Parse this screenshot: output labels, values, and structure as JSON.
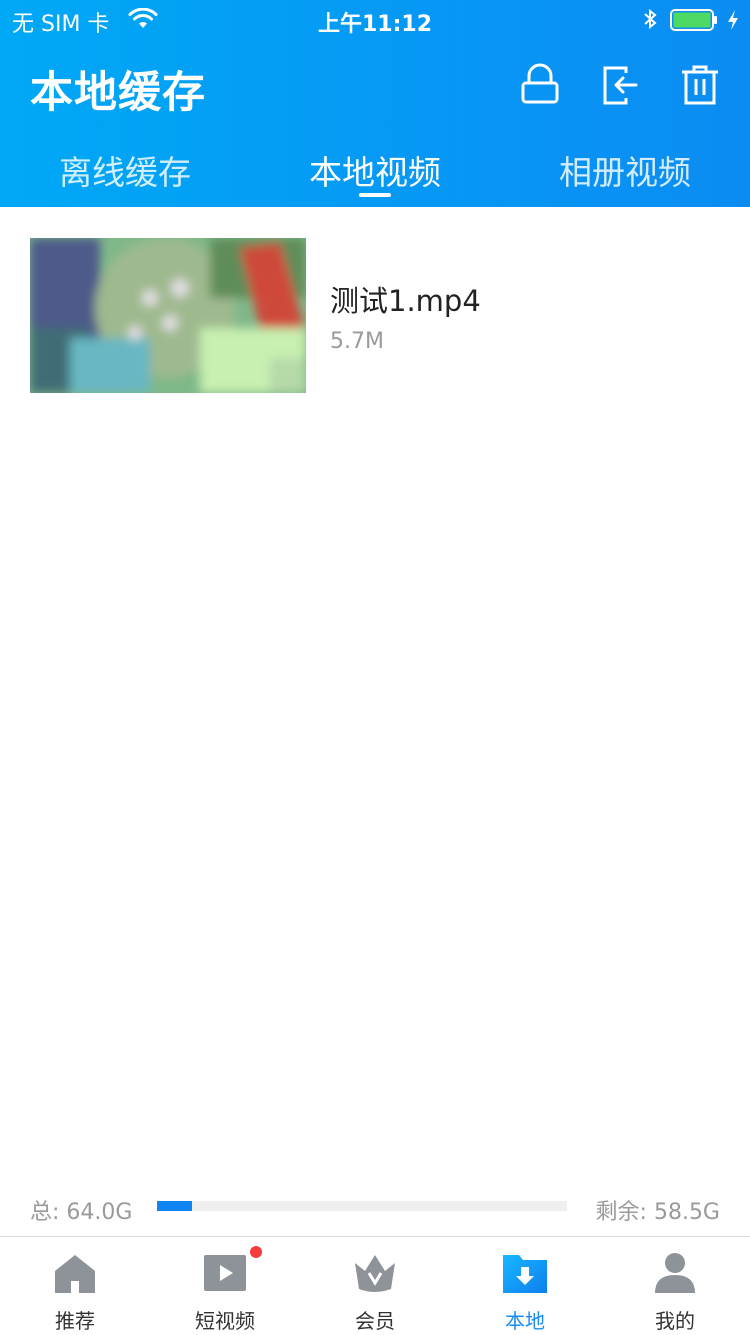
{
  "status_bar": {
    "carrier": "无 SIM 卡",
    "time": "上午11:12",
    "battery_level": 1.0,
    "battery_color": "#4cd964"
  },
  "header": {
    "title": "本地缓存",
    "icons": [
      "lock-icon",
      "export-icon",
      "trash-icon"
    ],
    "gradient": [
      "#00a8f6",
      "#0b8cf2"
    ]
  },
  "tabs": [
    {
      "label": "离线缓存",
      "active": false
    },
    {
      "label": "本地视频",
      "active": true
    },
    {
      "label": "相册视频",
      "active": false
    }
  ],
  "videos": [
    {
      "name": "测试1.mp4",
      "size": "5.7M"
    }
  ],
  "storage": {
    "total_label": "总: 64.0G",
    "remaining_label": "剩余: 58.5G",
    "used_fraction": 0.086,
    "bar_color": "#1084f0"
  },
  "tabbar": {
    "items": [
      {
        "label": "推荐",
        "icon": "home-icon",
        "active": false
      },
      {
        "label": "短视频",
        "icon": "play-icon",
        "active": false,
        "badge": true
      },
      {
        "label": "会员",
        "icon": "crown-icon",
        "active": false
      },
      {
        "label": "本地",
        "icon": "download-folder-icon",
        "active": true
      },
      {
        "label": "我的",
        "icon": "user-icon",
        "active": false
      }
    ],
    "active_color": "#1a8cf0"
  }
}
